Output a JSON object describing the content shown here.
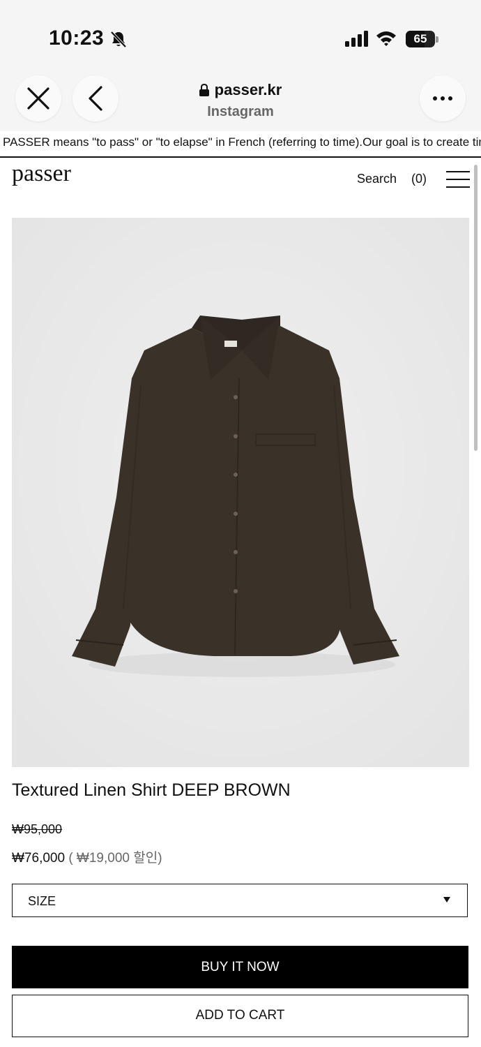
{
  "status_bar": {
    "time": "10:23",
    "battery": "65",
    "icons": [
      "bell-slash-icon",
      "cellular-signal-icon",
      "wifi-icon",
      "battery-icon"
    ]
  },
  "browser": {
    "url": "passer.kr",
    "source": "Instagram",
    "icons": [
      "close-icon",
      "back-chevron-icon",
      "lock-icon",
      "more-icon"
    ]
  },
  "marquee": {
    "text": "PASSER means \"to pass\" or \"to elapse\" in French (referring to time).Our goal is to create time"
  },
  "site_header": {
    "logo": "passer",
    "search_label": "Search",
    "cart_count": "(0)",
    "menu_icon": "hamburger-menu-icon"
  },
  "product": {
    "image_alt": "dark brown long-sleeve shirt",
    "image_color": "#3a3129",
    "title": "Textured Linen Shirt DEEP BROWN",
    "original_price": "₩95,000",
    "sale_price": "₩76,000",
    "discount": "( ₩19,000 할인)",
    "size_select": {
      "selected": "SIZE"
    },
    "buy_now_label": "BUY IT NOW",
    "add_to_cart_label": "ADD TO CART"
  },
  "colors": {
    "accent": "#000000",
    "background": "#ffffff",
    "image_bg": "#ebebeb"
  }
}
